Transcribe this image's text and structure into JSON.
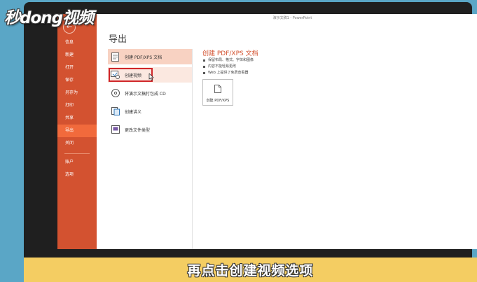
{
  "watermark": {
    "text": "秒dong视频"
  },
  "window": {
    "title": "演示文稿1 - PowerPoint"
  },
  "nav": {
    "back_glyph": "←",
    "items": [
      {
        "label": "信息"
      },
      {
        "label": "新建"
      },
      {
        "label": "打开"
      },
      {
        "label": "保存"
      },
      {
        "label": "另存为"
      },
      {
        "label": "打印"
      },
      {
        "label": "共享"
      },
      {
        "label": "导出"
      },
      {
        "label": "关闭"
      },
      {
        "label": "账户"
      },
      {
        "label": "选项"
      }
    ],
    "active_index": 7
  },
  "main": {
    "title": "导出",
    "options": [
      {
        "label": "创建 PDF/XPS 文档",
        "icon": "pdf-document-icon"
      },
      {
        "label": "创建视频",
        "icon": "video-icon"
      },
      {
        "label": "将演示文稿打包成 CD",
        "icon": "cd-icon"
      },
      {
        "label": "创建讲义",
        "icon": "handout-icon"
      },
      {
        "label": "更改文件类型",
        "icon": "file-type-icon"
      }
    ]
  },
  "detail": {
    "title": "创建 PDF/XPS 文档",
    "bullets": [
      "保留布局、格式、字体和图像",
      "内容不能轻易更改",
      "Web 上提供了免费查看器"
    ],
    "button_label": "创建 PDF/XPS"
  },
  "caption": {
    "text": "再点击创建视频选项"
  },
  "colors": {
    "accent": "#d35230",
    "nav_active": "#f16a3c",
    "highlight": "#d0262a",
    "caption_bg": "#f4cd62"
  }
}
